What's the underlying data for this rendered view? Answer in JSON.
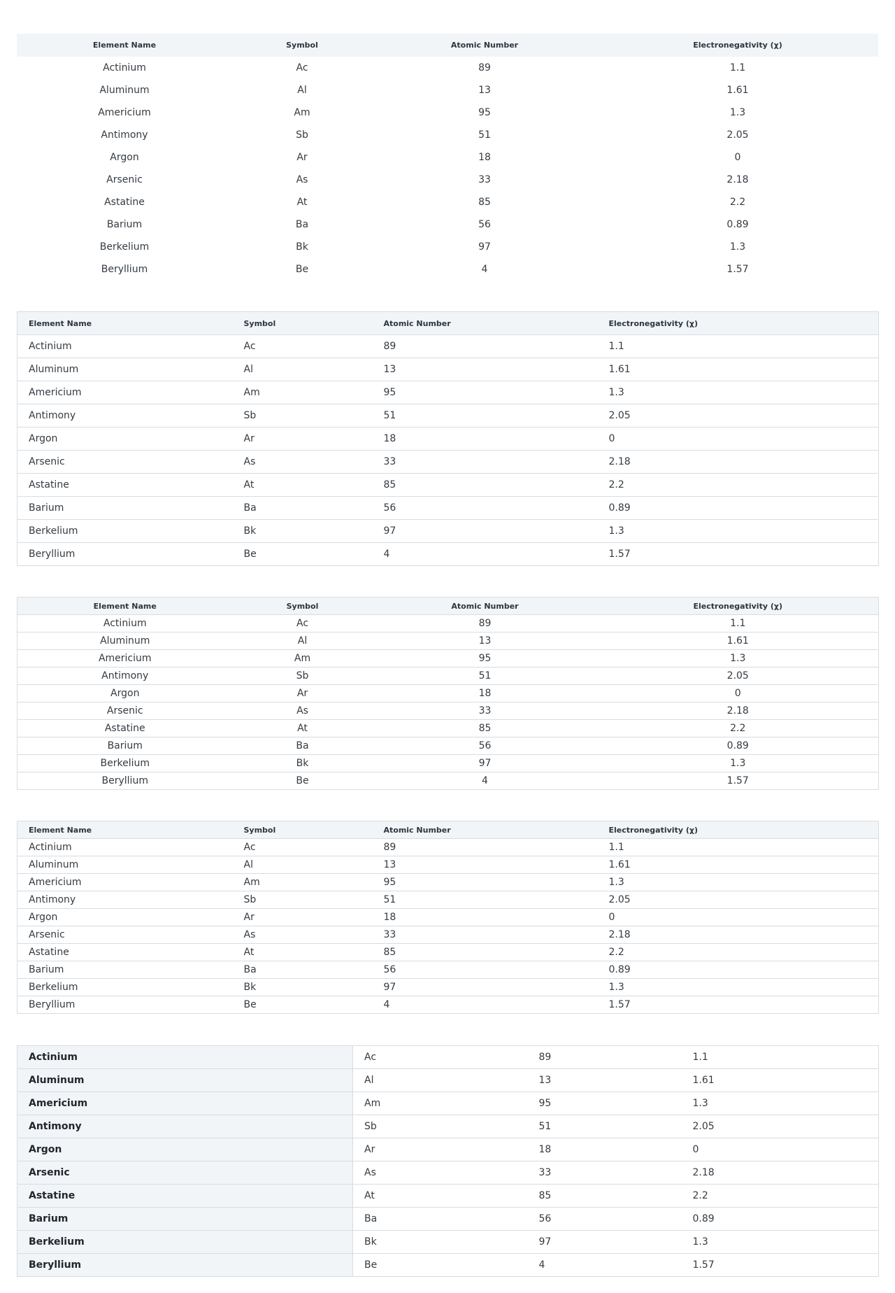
{
  "columns": {
    "name": "Element Name",
    "symbol": "Symbol",
    "atomic_number": "Atomic Number",
    "electronegativity": "Electronegativity (χ)"
  },
  "elements": [
    {
      "name": "Actinium",
      "symbol": "Ac",
      "atomic_number": "89",
      "electronegativity": "1.1"
    },
    {
      "name": "Aluminum",
      "symbol": "Al",
      "atomic_number": "13",
      "electronegativity": "1.61"
    },
    {
      "name": "Americium",
      "symbol": "Am",
      "atomic_number": "95",
      "electronegativity": "1.3"
    },
    {
      "name": "Antimony",
      "symbol": "Sb",
      "atomic_number": "51",
      "electronegativity": "2.05"
    },
    {
      "name": "Argon",
      "symbol": "Ar",
      "atomic_number": "18",
      "electronegativity": "0"
    },
    {
      "name": "Arsenic",
      "symbol": "As",
      "atomic_number": "33",
      "electronegativity": "2.18"
    },
    {
      "name": "Astatine",
      "symbol": "At",
      "atomic_number": "85",
      "electronegativity": "2.2"
    },
    {
      "name": "Barium",
      "symbol": "Ba",
      "atomic_number": "56",
      "electronegativity": "0.89"
    },
    {
      "name": "Berkelium",
      "symbol": "Bk",
      "atomic_number": "97",
      "electronegativity": "1.3"
    },
    {
      "name": "Beryllium",
      "symbol": "Be",
      "atomic_number": "4",
      "electronegativity": "1.57"
    }
  ],
  "colors": {
    "header_bg": "#f1f5f8",
    "border": "#d6dde3",
    "text": "#343b42"
  }
}
